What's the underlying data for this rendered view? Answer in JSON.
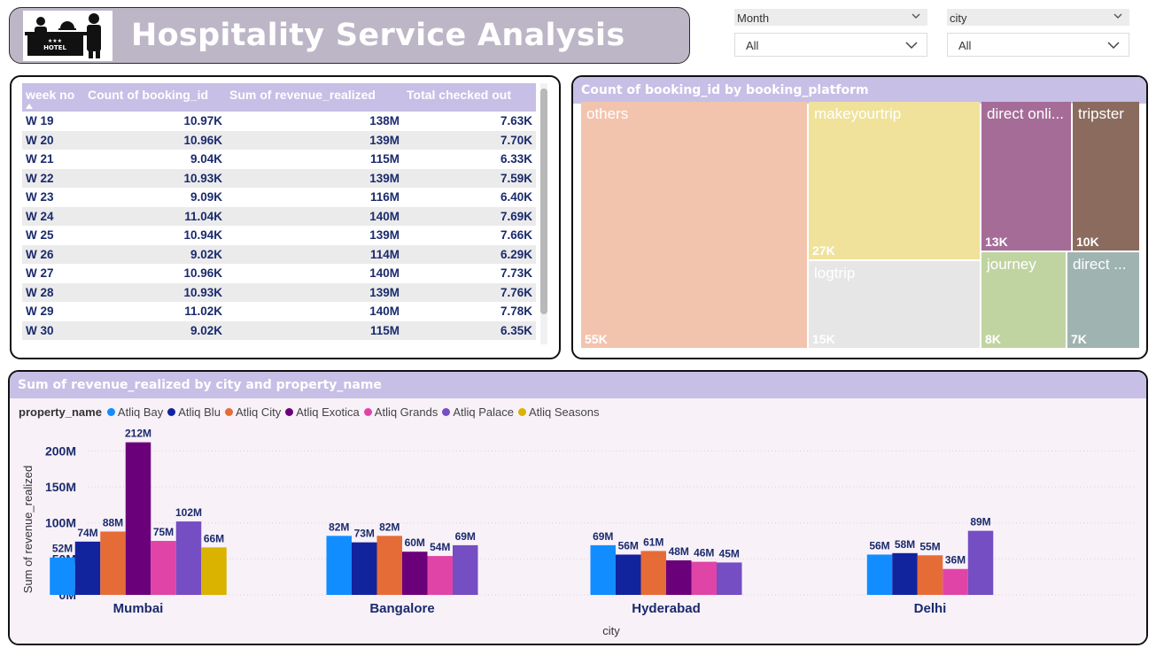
{
  "header": {
    "title": "Hospitality Service Analysis",
    "logo_text": "HOTEL"
  },
  "slicers": [
    {
      "label": "Month",
      "value": "All"
    },
    {
      "label": "city",
      "value": "All"
    }
  ],
  "table": {
    "columns": [
      "week no",
      "Count of booking_id",
      "Sum of revenue_realized",
      "Total checked out"
    ],
    "rows": [
      [
        "W 19",
        "10.97K",
        "138M",
        "7.63K"
      ],
      [
        "W 20",
        "10.96K",
        "139M",
        "7.70K"
      ],
      [
        "W 21",
        "9.04K",
        "115M",
        "6.33K"
      ],
      [
        "W 22",
        "10.93K",
        "139M",
        "7.59K"
      ],
      [
        "W 23",
        "9.09K",
        "116M",
        "6.40K"
      ],
      [
        "W 24",
        "11.04K",
        "140M",
        "7.69K"
      ],
      [
        "W 25",
        "10.94K",
        "139M",
        "7.66K"
      ],
      [
        "W 26",
        "9.02K",
        "114M",
        "6.29K"
      ],
      [
        "W 27",
        "10.96K",
        "140M",
        "7.73K"
      ],
      [
        "W 28",
        "10.93K",
        "139M",
        "7.76K"
      ],
      [
        "W 29",
        "11.02K",
        "140M",
        "7.78K"
      ],
      [
        "W 30",
        "9.02K",
        "115M",
        "6.35K"
      ]
    ]
  },
  "chart_data": [
    {
      "type": "treemap",
      "title": "Count of booking_id by booking_platform",
      "items": [
        {
          "label": "others",
          "value": "55K",
          "color": "#f2c4ae"
        },
        {
          "label": "makeyourtrip",
          "value": "27K",
          "color": "#f0e29b"
        },
        {
          "label": "logtrip",
          "value": "15K",
          "color": "#e6e6e6"
        },
        {
          "label": "direct onli...",
          "value": "13K",
          "color": "#a56c98"
        },
        {
          "label": "tripster",
          "value": "10K",
          "color": "#8b6b5e"
        },
        {
          "label": "journey",
          "value": "8K",
          "color": "#c0d4a2"
        },
        {
          "label": "direct ...",
          "value": "7K",
          "color": "#9fb4b0"
        }
      ]
    },
    {
      "type": "bar",
      "title": "Sum of revenue_realized by city and property_name",
      "legend_title": "property_name",
      "xlabel": "city",
      "ylabel": "Sum of revenue_realized",
      "yticks": [
        "0M",
        "50M",
        "100M",
        "150M",
        "200M"
      ],
      "ylim": [
        0,
        230
      ],
      "categories": [
        "Mumbai",
        "Bangalore",
        "Hyderabad",
        "Delhi"
      ],
      "series": [
        {
          "name": "Atliq Bay",
          "color": "#118dff",
          "values": [
            52,
            82,
            69,
            56
          ]
        },
        {
          "name": "Atliq Blu",
          "color": "#12239e",
          "values": [
            74,
            73,
            56,
            58
          ]
        },
        {
          "name": "Atliq City",
          "color": "#e66c37",
          "values": [
            88,
            82,
            61,
            55
          ]
        },
        {
          "name": "Atliq Exotica",
          "color": "#6b007b",
          "values": [
            212,
            60,
            48,
            null
          ]
        },
        {
          "name": "Atliq Grands",
          "color": "#e044a7",
          "values": [
            75,
            54,
            46,
            36
          ]
        },
        {
          "name": "Atliq Palace",
          "color": "#744ec2",
          "values": [
            102,
            69,
            45,
            89
          ]
        },
        {
          "name": "Atliq Seasons",
          "color": "#d9b300",
          "values": [
            66,
            null,
            null,
            null
          ]
        }
      ],
      "value_labels": [
        [
          "52M",
          "74M",
          "88M",
          "212M",
          "75M",
          "102M",
          "66M"
        ],
        [
          "82M",
          "73M",
          "82M",
          "60M",
          "54M",
          "69M",
          ""
        ],
        [
          "69M",
          "56M",
          "61M",
          "48M",
          "46M",
          "45M",
          ""
        ],
        [
          "56M",
          "58M",
          "55M",
          "",
          "36M",
          "89M",
          ""
        ]
      ]
    }
  ]
}
